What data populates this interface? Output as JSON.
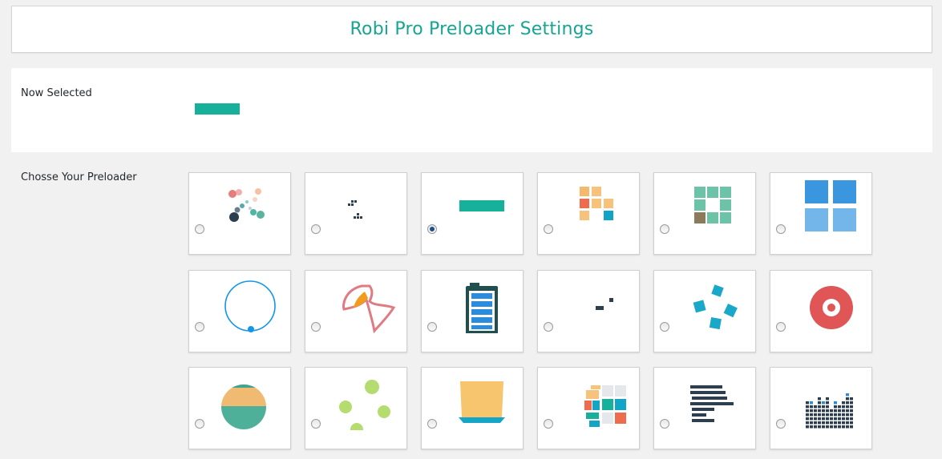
{
  "page_title": "Robi Pro Preloader Settings",
  "now_selected": {
    "label": "Now Selected",
    "color": "#17b09b"
  },
  "choose_label": "Chosse Your Preloader",
  "selected_index": 2,
  "preloaders": [
    {
      "icon": "scatter-dots-icon",
      "checked": false
    },
    {
      "icon": "pixel-steps-icon",
      "checked": false
    },
    {
      "icon": "teal-bar-icon",
      "checked": true
    },
    {
      "icon": "tile-grid-icon",
      "checked": false
    },
    {
      "icon": "green-grid-icon",
      "checked": false
    },
    {
      "icon": "blue-squares-icon",
      "checked": false
    },
    {
      "icon": "circle-orbit-icon",
      "checked": false
    },
    {
      "icon": "ribbon-bow-icon",
      "checked": false
    },
    {
      "icon": "battery-icon",
      "checked": false
    },
    {
      "icon": "moving-dots-icon",
      "checked": false
    },
    {
      "icon": "rotating-squares-icon",
      "checked": false
    },
    {
      "icon": "target-icon",
      "checked": false
    },
    {
      "icon": "split-circle-icon",
      "checked": false
    },
    {
      "icon": "green-balls-icon",
      "checked": false
    },
    {
      "icon": "yellow-bucket-icon",
      "checked": false
    },
    {
      "icon": "color-blocks-icon",
      "checked": false
    },
    {
      "icon": "text-lines-icon",
      "checked": false
    },
    {
      "icon": "equalizer-icon",
      "checked": false
    }
  ]
}
